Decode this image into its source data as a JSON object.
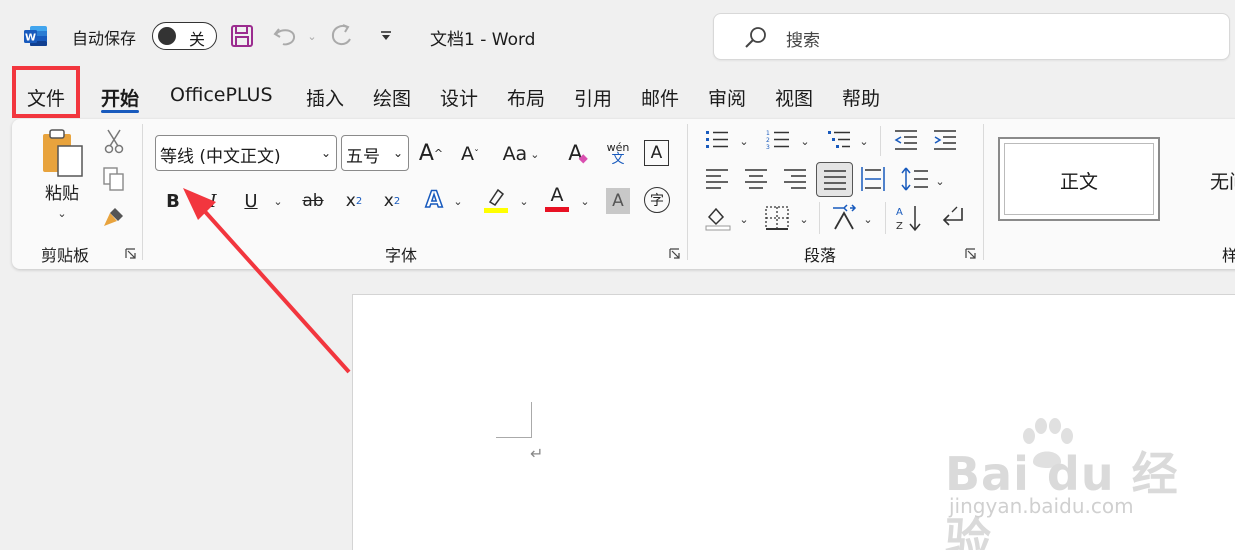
{
  "titlebar": {
    "autosave_label": "自动保存",
    "autosave_state": "关",
    "document_title": "文档1  -  Word",
    "search_placeholder": "搜索"
  },
  "tabs": [
    {
      "label": "文件"
    },
    {
      "label": "开始"
    },
    {
      "label": "OfficePLUS"
    },
    {
      "label": "插入"
    },
    {
      "label": "绘图"
    },
    {
      "label": "设计"
    },
    {
      "label": "布局"
    },
    {
      "label": "引用"
    },
    {
      "label": "邮件"
    },
    {
      "label": "审阅"
    },
    {
      "label": "视图"
    },
    {
      "label": "帮助"
    }
  ],
  "ribbon": {
    "clipboard": {
      "paste_label": "粘贴",
      "group_label": "剪贴板"
    },
    "font": {
      "font_name": "等线 (中文正文)",
      "font_size": "五号",
      "group_label": "字体",
      "bold": "B",
      "italic": "I",
      "underline": "U",
      "strike": "ab",
      "case": "Aa",
      "phonetic_top": "wén",
      "phonetic_bottom": "文",
      "char_border": "A",
      "enclose": "字"
    },
    "paragraph": {
      "group_label": "段落"
    },
    "styles": {
      "normal": "正文",
      "no_spacing": "无间",
      "group_label_partial": "样"
    }
  },
  "colors": {
    "accent": "#185abd",
    "highlight_box": "#f2363e",
    "font_color_bar": "#e81123",
    "highlight_bar": "#ffff00",
    "word_blue": "#185abd"
  },
  "watermark": {
    "brand": "Bai du 经验",
    "url": "jingyan.baidu.com"
  }
}
